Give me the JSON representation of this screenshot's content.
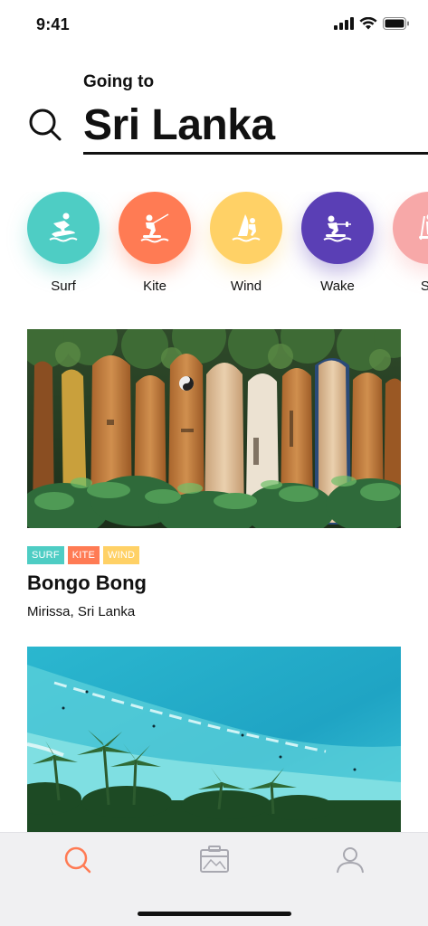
{
  "status": {
    "time": "9:41"
  },
  "header": {
    "going_to": "Going to",
    "destination": "Sri Lanka"
  },
  "categories": [
    {
      "label": "Surf",
      "color": "#4ecdc4",
      "icon": "surfer-icon"
    },
    {
      "label": "Kite",
      "color": "#ff7b54",
      "icon": "kitesurfer-icon"
    },
    {
      "label": "Wind",
      "color": "#ffd166",
      "icon": "windsurfer-icon"
    },
    {
      "label": "Wake",
      "color": "#5a3fb5",
      "icon": "wakeboarder-icon"
    },
    {
      "label": "Su",
      "color": "#f7a8a8",
      "icon": "sup-icon"
    }
  ],
  "cards": [
    {
      "tags": [
        {
          "label": "SURF",
          "color": "#4ecdc4"
        },
        {
          "label": "KITE",
          "color": "#ff7b54"
        },
        {
          "label": "WIND",
          "color": "#ffd166"
        }
      ],
      "title": "Bongo Bong",
      "subtitle": "Mirissa, Sri Lanka",
      "image": "surfboards-photo"
    },
    {
      "image": "beach-aerial-photo"
    }
  ],
  "tab_bar": {
    "active_color": "#ff7b54",
    "inactive_color": "#a8a8b0",
    "tabs": [
      "search-tab",
      "trips-tab",
      "profile-tab"
    ]
  }
}
